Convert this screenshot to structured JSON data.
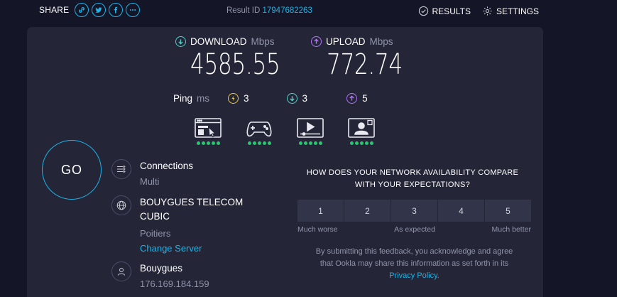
{
  "header": {
    "share_label": "SHARE",
    "share_icons": [
      "link-icon",
      "twitter-icon",
      "facebook-icon",
      "more-icon"
    ],
    "result_id_label": "Result ID",
    "result_id_value": "17947682263",
    "results_label": "RESULTS",
    "settings_label": "SETTINGS"
  },
  "download": {
    "label": "DOWNLOAD",
    "unit": "Mbps",
    "value": "4585.55",
    "color": "#4fd1c5"
  },
  "upload": {
    "label": "UPLOAD",
    "unit": "Mbps",
    "value": "772.74",
    "color": "#b770ff"
  },
  "ping": {
    "label": "Ping",
    "unit": "ms",
    "idle": "3",
    "download": "3",
    "upload": "5",
    "idle_color": "#e6c84a",
    "download_color": "#4fd1c5",
    "upload_color": "#b770ff"
  },
  "apps": [
    {
      "icon": "web-browsing-icon",
      "rating": 5
    },
    {
      "icon": "gaming-icon",
      "rating": 5
    },
    {
      "icon": "video-streaming-icon",
      "rating": 5
    },
    {
      "icon": "video-chat-icon",
      "rating": 5
    }
  ],
  "go_label": "GO",
  "connections": {
    "title": "Connections",
    "value": "Multi"
  },
  "server": {
    "name_line1": "BOUYGUES TELECOM",
    "name_line2": "CUBIC",
    "location": "Poitiers",
    "change_label": "Change Server"
  },
  "provider": {
    "name": "Bouygues",
    "ip": "176.169.184.159"
  },
  "survey": {
    "question_line1": "HOW DOES YOUR NETWORK AVAILABILITY COMPARE",
    "question_line2": "WITH YOUR EXPECTATIONS?",
    "options": [
      "1",
      "2",
      "3",
      "4",
      "5"
    ],
    "low_label": "Much worse",
    "mid_label": "As expected",
    "high_label": "Much better",
    "disclaimer_line1": "By submitting this feedback, you acknowledge and agree",
    "disclaimer_line2": "that Ookla may share this information as set forth in its",
    "privacy_link": "Privacy Policy",
    "disclaimer_end": "."
  },
  "colors": {
    "accent": "#1cb4e8",
    "background": "#141526",
    "panel": "#242638",
    "rating_dot": "#28c76f"
  }
}
